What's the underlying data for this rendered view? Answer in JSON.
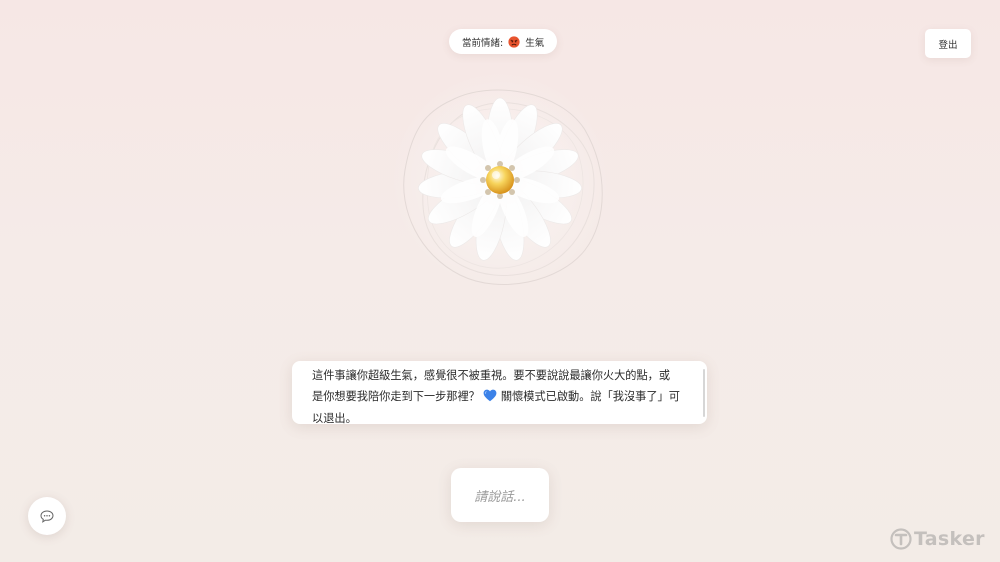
{
  "header": {
    "mood_label": "當前情緒:",
    "mood_value": "生氣",
    "mood_icon": "angry-face-icon",
    "logout_label": "登出"
  },
  "message": {
    "text_before_icon": "這件事讓你超級生氣，感覺很不被重視。要不要說說最讓你火大的點，或是你想要我陪你走到下一步那裡？ ",
    "icon": "blue-heart-icon",
    "text_after_icon": " 關懷模式已啟動。說「我沒事了」可以退出。"
  },
  "input": {
    "speak_placeholder": "請說話..."
  },
  "chat_button": {
    "icon": "speech-bubble-icon"
  },
  "watermark": {
    "text": "Tasker"
  },
  "colors": {
    "background_top": "#f6e7e5",
    "background_bottom": "#f3ece7",
    "card": "#ffffff",
    "heart": "#3c82e8",
    "angry_face": "#e8542e"
  }
}
